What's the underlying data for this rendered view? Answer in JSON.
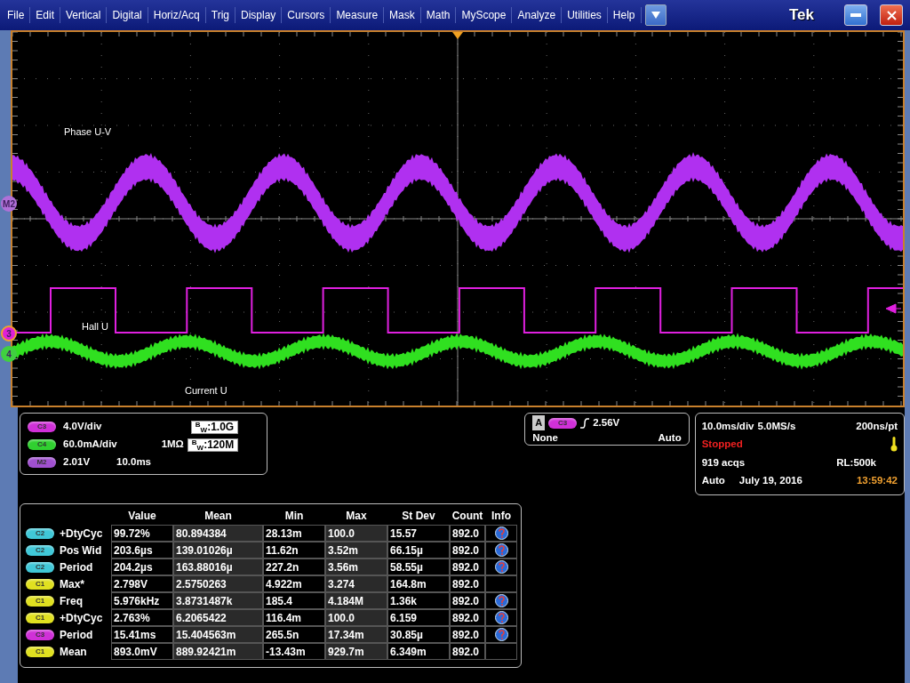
{
  "menu": {
    "items": [
      "File",
      "Edit",
      "Vertical",
      "Digital",
      "Horiz/Acq",
      "Trig",
      "Display",
      "Cursors",
      "Measure",
      "Mask",
      "Math",
      "MyScope",
      "Analyze",
      "Utilities",
      "Help"
    ],
    "brand": "Tek"
  },
  "scope": {
    "trace_labels": [
      "Phase U-V",
      "Hall U",
      "Current U"
    ],
    "markers": [
      {
        "label": "M2",
        "color": "#b070d8"
      },
      {
        "label": "3",
        "color": "#e020d8"
      },
      {
        "label": "4",
        "color": "#40d040"
      }
    ]
  },
  "channels": [
    {
      "badge": "C3",
      "color": "#d030d8",
      "scale": "4.0V/div",
      "bandwidth": "$^{B}$$_{W}$:1.0G"
    },
    {
      "badge": "C4",
      "color": "#30d030",
      "scale": "60.0mA/div",
      "impedance": "1MΩ",
      "bandwidth": "$^{B}$$_{W}$:120M"
    },
    {
      "badge": "M2",
      "color": "#a050d0",
      "scale": "2.01V",
      "position": "10.0ms"
    }
  ],
  "trigger": {
    "type": "A",
    "source": "C3",
    "color": "#d030d8",
    "level": "2.56V",
    "coupling": "None",
    "mode": "Auto"
  },
  "acquisition": {
    "timebase": "10.0ms/div",
    "sample_rate": "5.0MS/s",
    "resolution": "200ns/pt",
    "state": "Stopped",
    "acqs": "919 acqs",
    "record_length": "RL:500k",
    "mode": "Auto",
    "date": "July 19, 2016",
    "time": "13:59:42"
  },
  "measurements": {
    "columns": [
      "Value",
      "Mean",
      "Min",
      "Max",
      "St Dev",
      "Count",
      "Info"
    ],
    "rows": [
      {
        "source": "C2",
        "color": "#40c8d8",
        "name": "+DtyCyc",
        "values": [
          "99.72%",
          "80.894384",
          "28.13m",
          "100.0",
          "15.57",
          "892.0"
        ],
        "info": true
      },
      {
        "source": "C2",
        "color": "#40c8d8",
        "name": "Pos Wid",
        "values": [
          "203.6µs",
          "139.01026µ",
          "11.62n",
          "3.52m",
          "66.15µ",
          "892.0"
        ],
        "info": true
      },
      {
        "source": "C2",
        "color": "#40c8d8",
        "name": "Period",
        "values": [
          "204.2µs",
          "163.88016µ",
          "227.2n",
          "3.56m",
          "58.55µ",
          "892.0"
        ],
        "info": true
      },
      {
        "source": "C1",
        "color": "#e0e020",
        "name": "Max*",
        "values": [
          "2.798V",
          "2.5750263",
          "4.922m",
          "3.274",
          "164.8m",
          "892.0"
        ],
        "info": false
      },
      {
        "source": "C1",
        "color": "#e0e020",
        "name": "Freq",
        "values": [
          "5.976kHz",
          "3.8731487k",
          "185.4",
          "4.184M",
          "1.36k",
          "892.0"
        ],
        "info": true
      },
      {
        "source": "C1",
        "color": "#e0e020",
        "name": "+DtyCyc",
        "values": [
          "2.763%",
          "6.2065422",
          "116.4m",
          "100.0",
          "6.159",
          "892.0"
        ],
        "info": true
      },
      {
        "source": "C3",
        "color": "#d030d8",
        "name": "Period",
        "values": [
          "15.41ms",
          "15.404563m",
          "265.5n",
          "17.34m",
          "30.85µ",
          "892.0"
        ],
        "info": true
      },
      {
        "source": "C1",
        "color": "#e0e020",
        "name": "Mean",
        "values": [
          "893.0mV",
          "889.92421m",
          "-13.43m",
          "929.7m",
          "6.349m",
          "892.0"
        ],
        "info": false
      }
    ]
  }
}
